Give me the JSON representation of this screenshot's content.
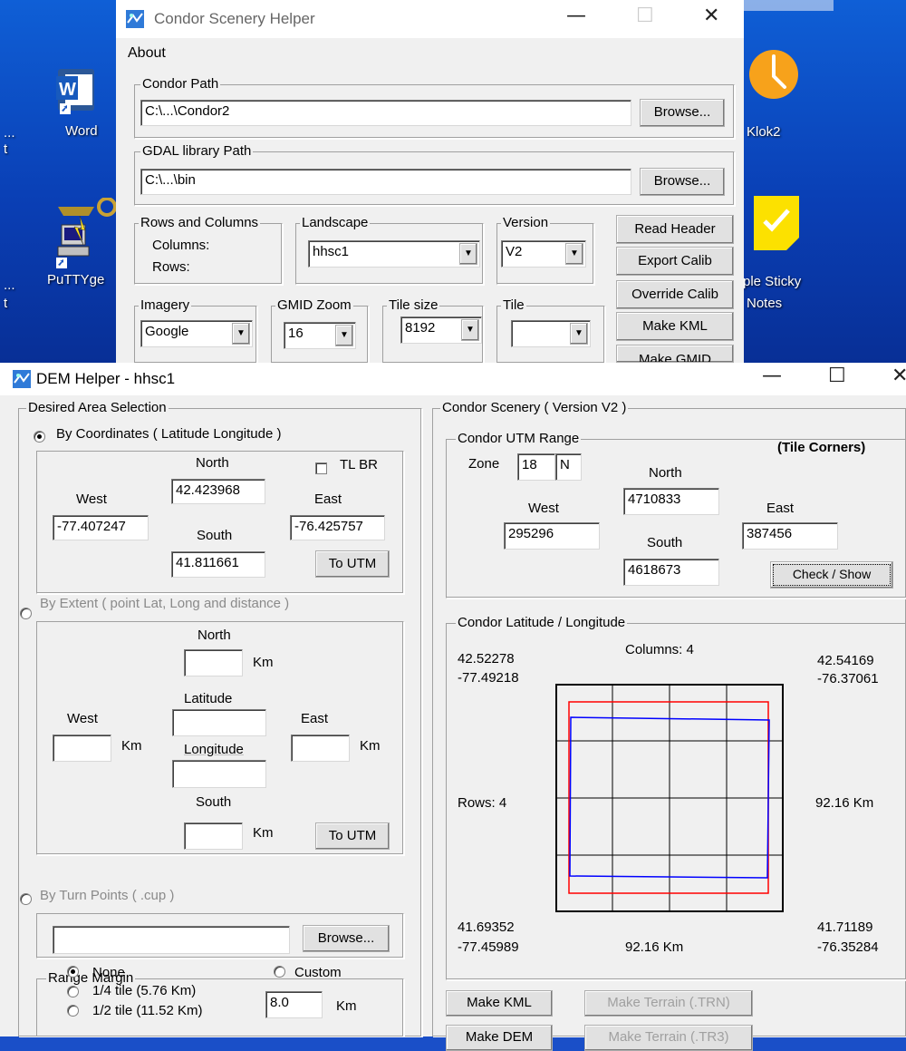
{
  "desktop": {
    "icons": [
      {
        "label": "Word",
        "icon": "word-icon"
      },
      {
        "label": "PuTTYge",
        "icon": "putty-icon"
      },
      {
        "label": "Klok2",
        "icon": "clock-icon"
      },
      {
        "label": "ple Sticky",
        "label2": "Notes",
        "icon": "sticky-notes-icon"
      }
    ],
    "edge_text": [
      "...",
      "t",
      "...",
      "t"
    ]
  },
  "helper": {
    "title": "Condor Scenery Helper",
    "menu_about": "About",
    "condor_path": {
      "label": "Condor Path",
      "value": "C:\\...\\Condor2",
      "browse": "Browse..."
    },
    "gdal_path": {
      "label": "GDAL library Path",
      "value": "C:\\...\\bin",
      "browse": "Browse..."
    },
    "rows_cols": {
      "label": "Rows and Columns",
      "columns": "Columns:",
      "rows": "Rows:"
    },
    "landscape": {
      "label": "Landscape",
      "value": "hhsc1"
    },
    "version": {
      "label": "Version",
      "value": "V2"
    },
    "imagery": {
      "label": "Imagery",
      "value": "Google"
    },
    "gmid_zoom": {
      "label": "GMID Zoom",
      "value": "16"
    },
    "tile_size": {
      "label": "Tile size",
      "value": "8192"
    },
    "tile": {
      "label": "Tile",
      "value": ""
    },
    "buttons": {
      "read_header": "Read Header",
      "export_calib": "Export Calib",
      "override_calib": "Override Calib",
      "make_kml": "Make KML",
      "make_gmid": "Make GMID"
    }
  },
  "dem": {
    "title": "DEM Helper - hhsc1",
    "area_selection": {
      "label": "Desired Area Selection",
      "by_coordinates": "By Coordinates ( Latitude  Longitude )",
      "north": "North",
      "north_value": "42.423968",
      "tl_br": "TL BR",
      "west": "West",
      "west_value": "-77.407247",
      "east": "East",
      "east_value": "-76.425757",
      "south": "South",
      "south_value": "41.811661",
      "to_utm": "To UTM",
      "by_extent": "By Extent ( point Lat, Long and distance )",
      "ext_north": "North",
      "ext_km": "Km",
      "ext_latitude": "Latitude",
      "ext_west": "West",
      "ext_east": "East",
      "ext_longitude": "Longitude",
      "ext_south": "South",
      "ext_to_utm": "To UTM",
      "by_turn_points": "By Turn Points ( .cup )",
      "browse": "Browse..."
    },
    "range_margin": {
      "label": "Range Margin",
      "none": "None",
      "quarter": "1/4 tile (5.76 Km)",
      "half": "1/2 tile (11.52 Km)",
      "custom": "Custom",
      "custom_value": "8.0",
      "km": "Km"
    },
    "condor_scenery": {
      "label": "Condor Scenery ( Version V2 )",
      "utm_range": "Condor UTM Range",
      "tile_corners": "(Tile Corners)",
      "zone_label": "Zone",
      "zone": "18",
      "hemisphere": "N",
      "north": "North",
      "north_value": "4710833",
      "west": "West",
      "west_value": "295296",
      "east": "East",
      "east_value": "387456",
      "south": "South",
      "south_value": "4618673",
      "check_show": "Check / Show"
    },
    "latlon": {
      "label": "Condor Latitude / Longitude",
      "tl_lat": "42.52278",
      "tl_lon": "-77.49218",
      "tr_lat": "42.54169",
      "tr_lon": "-76.37061",
      "bl_lat": "41.69352",
      "bl_lon": "-77.45989",
      "br_lat": "41.71189",
      "br_lon": "-76.35284",
      "columns": "Columns: 4",
      "rows": "Rows: 4",
      "height_km": "92.16 Km",
      "width_km": "92.16 Km",
      "grid_rows": 4,
      "grid_cols": 4
    },
    "buttons": {
      "make_kml": "Make KML",
      "make_dem": "Make DEM",
      "make_trn": "Make Terrain (.TRN)",
      "make_tr3": "Make Terrain (.TR3)"
    },
    "colors": {
      "outline_red": "#ff0000",
      "outline_blue": "#0000ff"
    }
  }
}
